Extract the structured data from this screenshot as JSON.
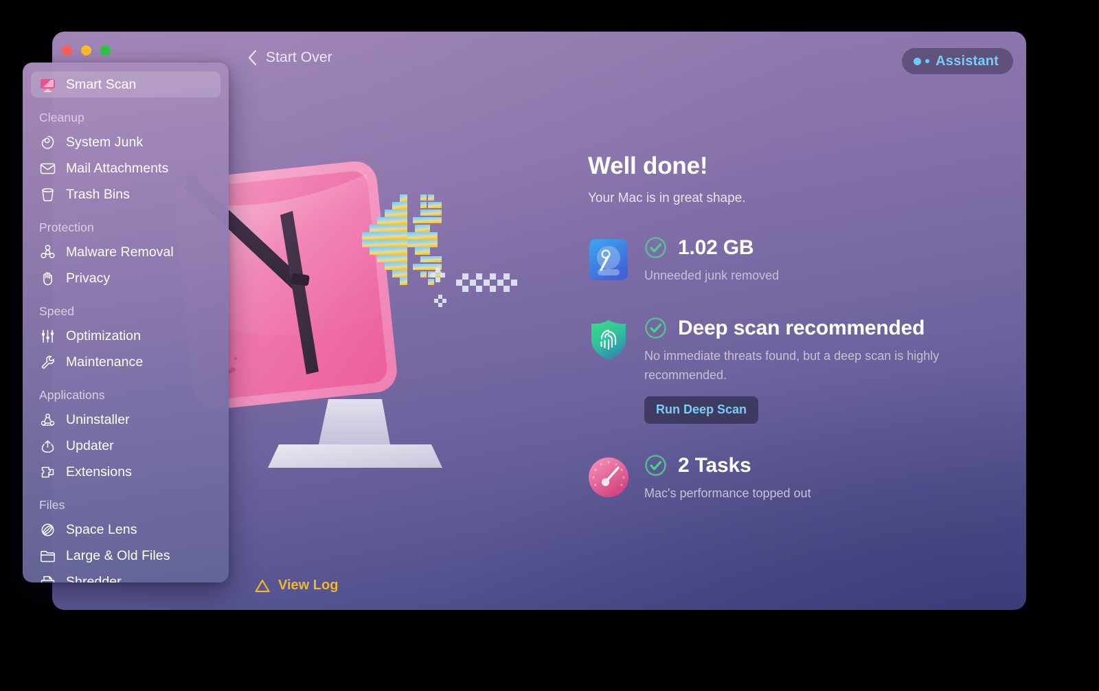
{
  "window": {
    "traffic_lights": [
      {
        "name": "close",
        "color": "#fc6058"
      },
      {
        "name": "minimize",
        "color": "#fdbc2f"
      },
      {
        "name": "maximize",
        "color": "#2bc940"
      }
    ],
    "back_label": "Start Over",
    "assistant_label": "Assistant",
    "accent_blue": "#78cdf8",
    "accent_green": "#4fd18b",
    "accent_amber": "#f0b928",
    "bg_top": "#9b80b2",
    "bg_bottom": "#424383"
  },
  "sidebar": {
    "selected": "Smart Scan",
    "groups": [
      {
        "section": null,
        "items": [
          {
            "label": "Smart Scan",
            "icon": "monitor-scan-icon",
            "selected": true
          }
        ]
      },
      {
        "section": "Cleanup",
        "items": [
          {
            "label": "System Junk",
            "icon": "junk-icon",
            "selected": false
          },
          {
            "label": "Mail Attachments",
            "icon": "envelope-icon",
            "selected": false
          },
          {
            "label": "Trash Bins",
            "icon": "trash-icon",
            "selected": false
          }
        ]
      },
      {
        "section": "Protection",
        "items": [
          {
            "label": "Malware Removal",
            "icon": "biohazard-icon",
            "selected": false
          },
          {
            "label": "Privacy",
            "icon": "hand-icon",
            "selected": false
          }
        ]
      },
      {
        "section": "Speed",
        "items": [
          {
            "label": "Optimization",
            "icon": "sliders-icon",
            "selected": false
          },
          {
            "label": "Maintenance",
            "icon": "wrench-icon",
            "selected": false
          }
        ]
      },
      {
        "section": "Applications",
        "items": [
          {
            "label": "Uninstaller",
            "icon": "uninstaller-icon",
            "selected": false
          },
          {
            "label": "Updater",
            "icon": "updater-icon",
            "selected": false
          },
          {
            "label": "Extensions",
            "icon": "puzzle-icon",
            "selected": false
          }
        ]
      },
      {
        "section": "Files",
        "items": [
          {
            "label": "Space Lens",
            "icon": "space-lens-icon",
            "selected": false
          },
          {
            "label": "Large & Old Files",
            "icon": "folder-icon",
            "selected": false
          },
          {
            "label": "Shredder",
            "icon": "shredder-icon",
            "selected": false
          }
        ]
      }
    ]
  },
  "main": {
    "headline": "Well done!",
    "subhead": "Your Mac is in great shape.",
    "results": [
      {
        "icon": "hard-drive-icon",
        "title": "1.02 GB",
        "description": "Unneeded junk removed",
        "status": "ok",
        "action": null
      },
      {
        "icon": "shield-fingerprint-icon",
        "title": "Deep scan recommended",
        "description": "No immediate threats found, but a deep scan is highly recommended.",
        "status": "ok",
        "action": "Run Deep Scan"
      },
      {
        "icon": "speedometer-icon",
        "title": "2 Tasks",
        "description": "Mac's performance topped out",
        "status": "ok",
        "action": null
      }
    ],
    "view_log_label": "View Log"
  }
}
